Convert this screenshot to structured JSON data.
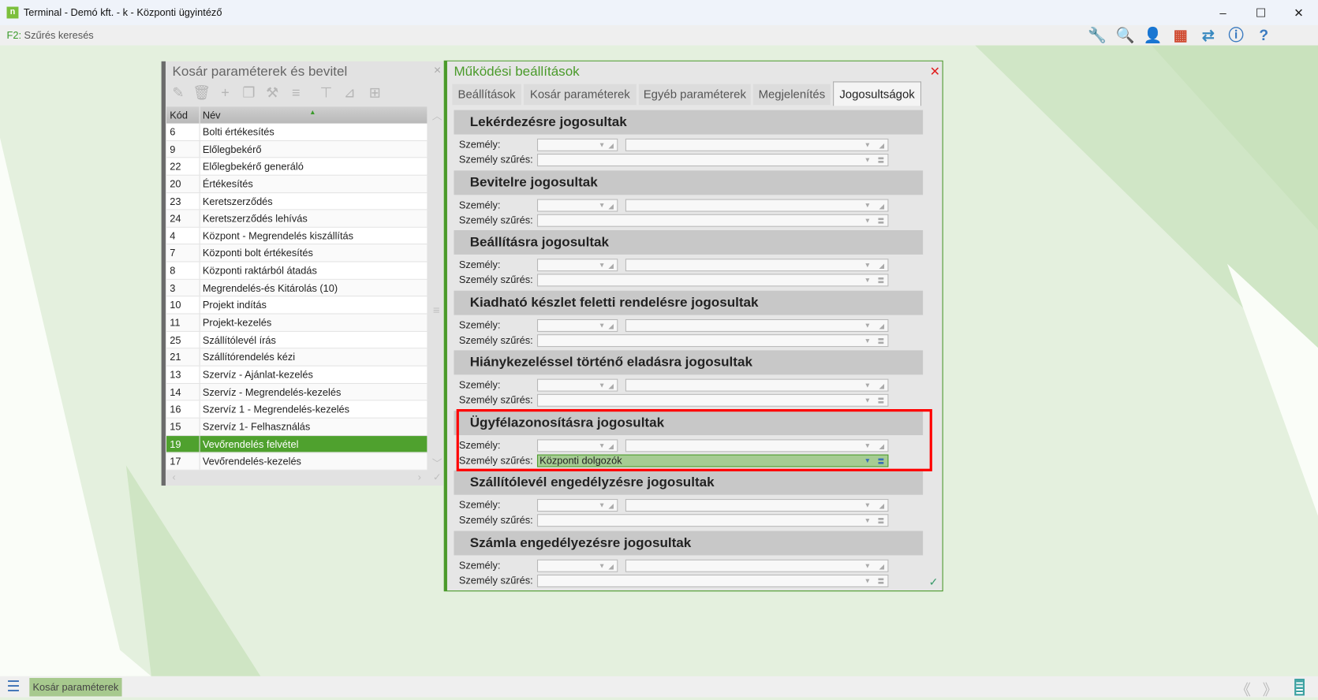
{
  "window": {
    "title": "Terminal - Demó kft. - k - Központi ügyintéző",
    "app_icon": "n",
    "controls": [
      "–",
      "☐",
      "✕"
    ]
  },
  "toolbar": {
    "shortcut_key": "F2:",
    "shortcut_label": " Szűrés keresés",
    "icons": [
      {
        "name": "wrench-icon",
        "glyph": "🔧",
        "color": "#3a9a6a"
      },
      {
        "name": "search-icon",
        "glyph": "🔍",
        "color": "#9a4ab5"
      },
      {
        "name": "user-icon",
        "glyph": "👤",
        "color": "#e8a860"
      },
      {
        "name": "apps-grid-icon",
        "glyph": "▦",
        "color": "#d04a30"
      },
      {
        "name": "swap-icon",
        "glyph": "⇄",
        "color": "#3a8ac0"
      },
      {
        "name": "info-icon",
        "glyph": "ⓘ",
        "color": "#3a7ac0"
      },
      {
        "name": "help-icon",
        "glyph": "?",
        "color": "#3a7ac0"
      }
    ]
  },
  "left_panel": {
    "title": "Kosár paraméterek és bevitel",
    "close": "×",
    "tools": [
      "✎",
      "🗑",
      "+",
      "❐",
      "⚒",
      "≡",
      "⊤",
      "⊿",
      "⊞"
    ],
    "columns": [
      "Kód",
      "Név"
    ],
    "rows": [
      [
        "6",
        "Bolti értékesítés"
      ],
      [
        "9",
        "Előlegbekérő"
      ],
      [
        "22",
        "Előlegbekérő generáló"
      ],
      [
        "20",
        "Értékesítés"
      ],
      [
        "23",
        "Keretszerződés"
      ],
      [
        "24",
        "Keretszerződés lehívás"
      ],
      [
        "4",
        "Központ - Megrendelés kiszállítás"
      ],
      [
        "7",
        "Központi bolt értékesítés"
      ],
      [
        "8",
        "Központi raktárból átadás"
      ],
      [
        "3",
        "Megrendelés-és Kitárolás (10)"
      ],
      [
        "10",
        "Projekt indítás"
      ],
      [
        "11",
        "Projekt-kezelés"
      ],
      [
        "25",
        "Szállítólevél írás"
      ],
      [
        "21",
        "Szállítórendelés kézi"
      ],
      [
        "13",
        "Szervíz - Ajánlat-kezelés"
      ],
      [
        "14",
        "Szervíz - Megrendelés-kezelés"
      ],
      [
        "16",
        "Szervíz 1 - Megrendelés-kezelés"
      ],
      [
        "15",
        "Szervíz 1- Felhasználás"
      ],
      [
        "19",
        "Vevőrendelés felvétel"
      ],
      [
        "17",
        "Vevőrendelés-kezelés"
      ]
    ],
    "selected_code": "19"
  },
  "right_panel": {
    "title": "Működési beállítások",
    "close": "✕",
    "tabs": [
      "Beállítások",
      "Kosár paraméterek",
      "Egyéb paraméterek",
      "Megjelenítés",
      "Jogosultságok"
    ],
    "active_tab": "Jogosultságok",
    "person_label": "Személy:",
    "filter_label": "Személy szűrés:",
    "sections": [
      {
        "title": "Lekérdezésre jogosultak",
        "filter": ""
      },
      {
        "title": "Bevitelre jogosultak",
        "filter": ""
      },
      {
        "title": "Beállításra jogosultak",
        "filter": ""
      },
      {
        "title": "Kiadható készlet feletti rendelésre jogosultak",
        "filter": ""
      },
      {
        "title": "Hiánykezeléssel történő eladásra jogosultak",
        "filter": ""
      },
      {
        "title": "Ügyfélazonosításra jogosultak",
        "filter": "Központi dolgozók"
      },
      {
        "title": "Szállítólevél engedélyzésre jogosultak",
        "filter": ""
      },
      {
        "title": "Számla engedélyezésre jogosultak",
        "filter": ""
      }
    ],
    "highlighted_section": "Ügyfélazonosításra jogosultak",
    "confirm": "✓"
  },
  "bottombar": {
    "tab": "Kosár paraméterek",
    "prev": "《",
    "next": "》"
  },
  "colors": {
    "accent": "#4a9a2a",
    "selected_row": "#4fa12e",
    "highlight_box": "#ff0000",
    "background": "#e4f0de"
  }
}
